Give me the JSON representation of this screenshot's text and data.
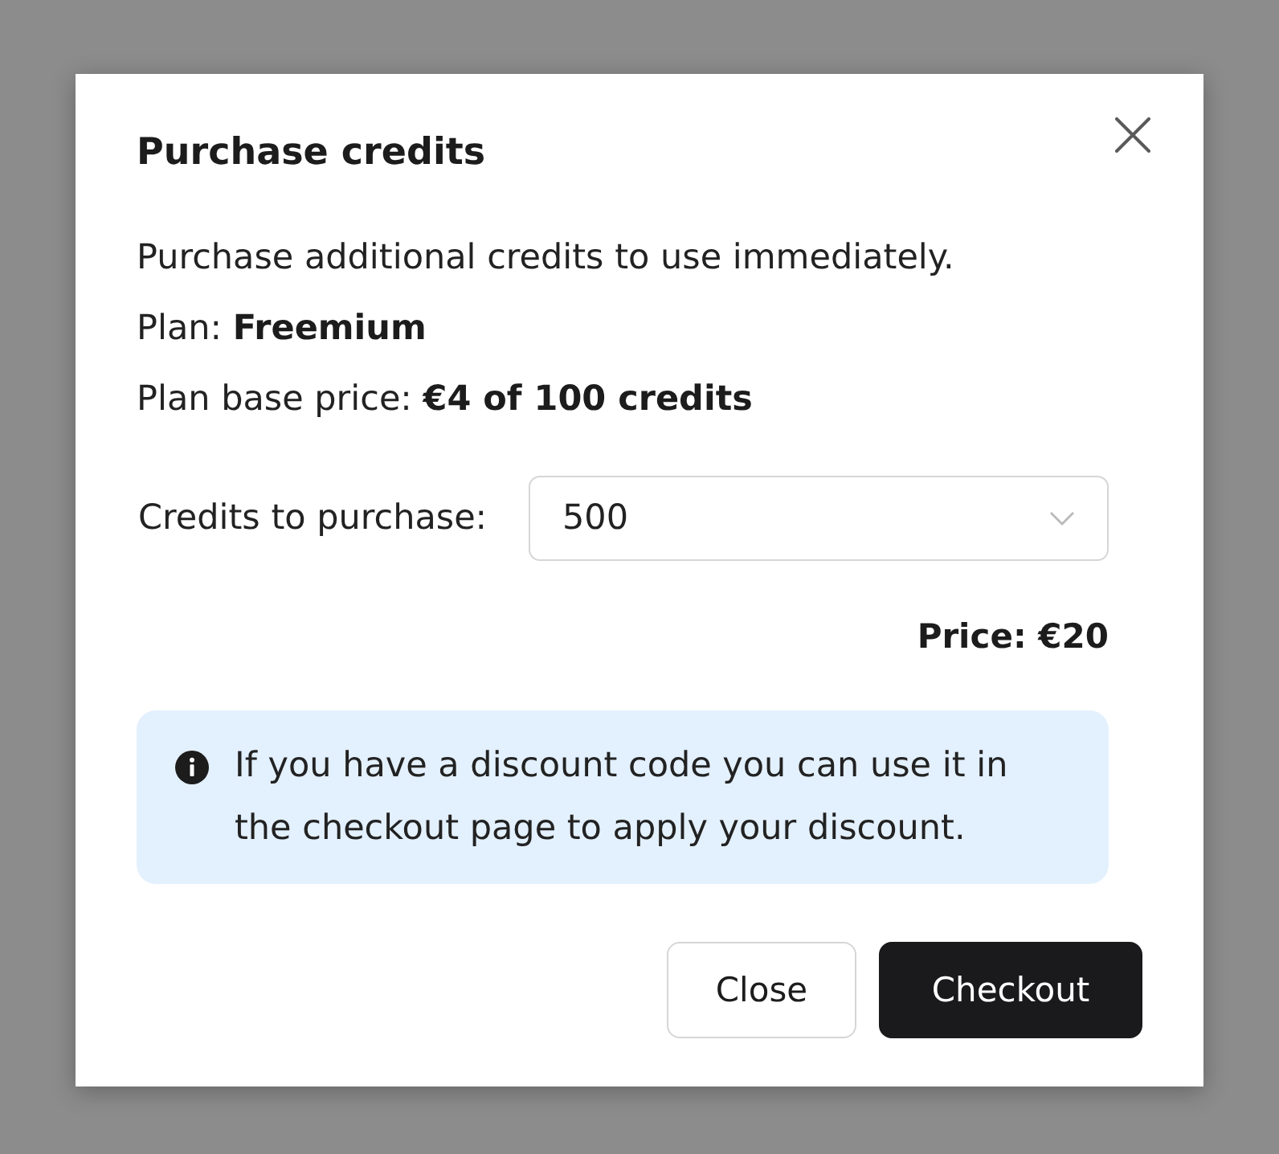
{
  "dialog": {
    "title": "Purchase credits",
    "description": "Purchase additional credits to use immediately.",
    "plan": "Plan: **Freemium**",
    "base_price": "Plan base price: **€4 of 100 credits**"
  },
  "credits_select": {
    "label": "Credits to purchase:",
    "value": "500"
  },
  "price": "Price: €20",
  "notice": {
    "text": "If you have a discount code you can use it in the checkout page to apply your discount."
  },
  "buttons": [
    {
      "label": "Close",
      "kind": "secondary"
    },
    {
      "label": "Checkout",
      "kind": "primary"
    }
  ]
}
